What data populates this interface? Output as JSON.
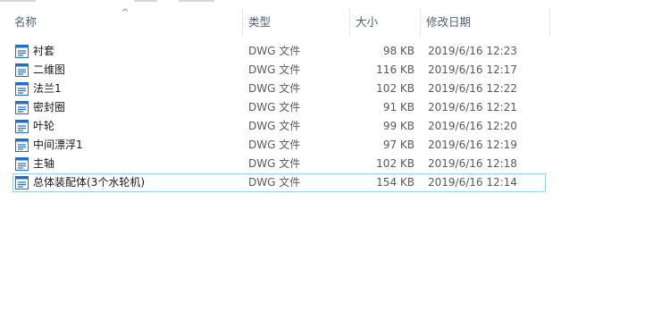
{
  "columns": {
    "name": "名称",
    "type": "类型",
    "size": "大小",
    "modified": "修改日期",
    "sort_indicator": "^"
  },
  "files": [
    {
      "name": "衬套",
      "type": "DWG 文件",
      "size": "98 KB",
      "modified": "2019/6/16 12:23"
    },
    {
      "name": "二维图",
      "type": "DWG 文件",
      "size": "116 KB",
      "modified": "2019/6/16 12:17"
    },
    {
      "name": "法兰1",
      "type": "DWG 文件",
      "size": "102 KB",
      "modified": "2019/6/16 12:22"
    },
    {
      "name": "密封圈",
      "type": "DWG 文件",
      "size": "91 KB",
      "modified": "2019/6/16 12:21"
    },
    {
      "name": "叶轮",
      "type": "DWG 文件",
      "size": "99 KB",
      "modified": "2019/6/16 12:20"
    },
    {
      "name": "中间漂浮1",
      "type": "DWG 文件",
      "size": "97 KB",
      "modified": "2019/6/16 12:19"
    },
    {
      "name": "主轴",
      "type": "DWG 文件",
      "size": "102 KB",
      "modified": "2019/6/16 12:18"
    },
    {
      "name": "总体装配体(3个水轮机)",
      "type": "DWG 文件",
      "size": "154 KB",
      "modified": "2019/6/16 12:14"
    }
  ],
  "file_icon": "dwg-file-icon",
  "colors": {
    "header_text": "#4c607a",
    "selection_border": "#99d1ff",
    "icon_blue": "#1f6fc5"
  }
}
